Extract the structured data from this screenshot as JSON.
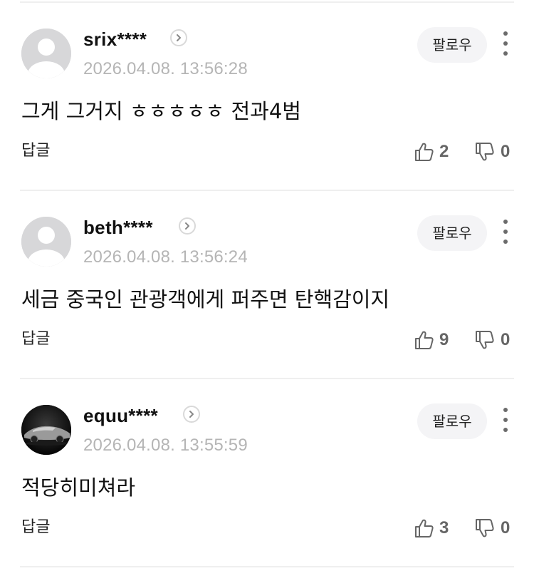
{
  "comments": [
    {
      "username": "srix****",
      "timestamp": "2026.04.08. 13:56:28",
      "text": "그게 그거지 ㅎㅎㅎㅎㅎ 전과4범",
      "follow_label": "팔로우",
      "reply_label": "답글",
      "likes": "2",
      "dislikes": "0",
      "avatar": "default-avatar-icon"
    },
    {
      "username": "beth****",
      "timestamp": "2026.04.08. 13:56:24",
      "text": "세금 중국인 관광객에게 퍼주면 탄핵감이지",
      "follow_label": "팔로우",
      "reply_label": "답글",
      "likes": "9",
      "dislikes": "0",
      "avatar": "default-avatar-icon"
    },
    {
      "username": "equu****",
      "timestamp": "2026.04.08. 13:55:59",
      "text": "적당히미쳐라",
      "follow_label": "팔로우",
      "reply_label": "답글",
      "likes": "3",
      "dislikes": "0",
      "avatar": "car-photo-avatar"
    }
  ],
  "colors": {
    "username": "#111111",
    "timestamp": "#b5b5b5",
    "follow_bg": "#f4f4f6",
    "divider": "#efefef",
    "icon": "#666666"
  }
}
